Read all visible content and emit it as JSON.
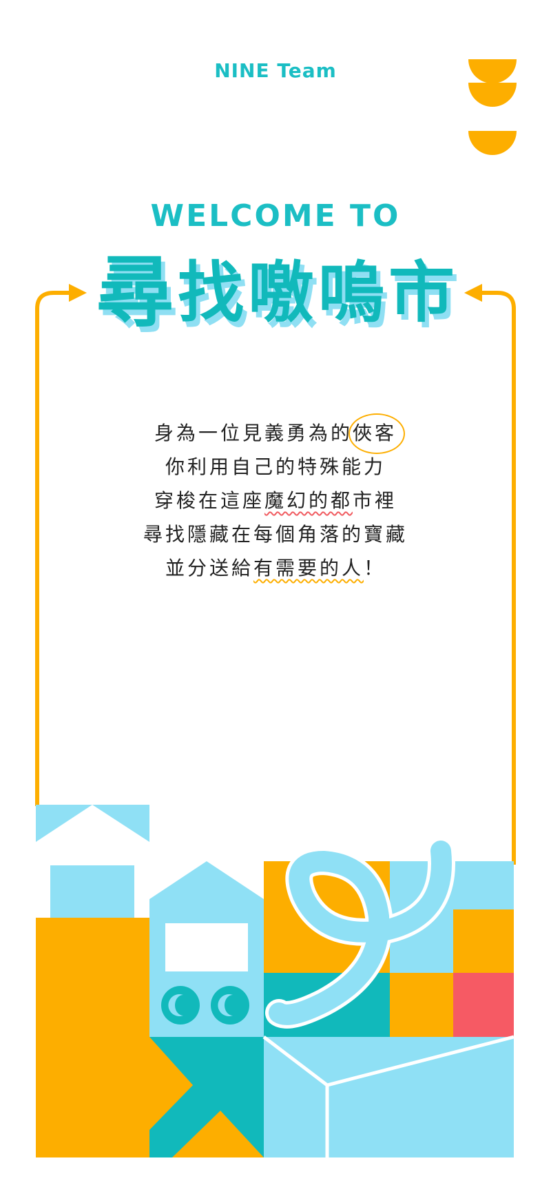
{
  "header": {
    "brand": "NINE Team"
  },
  "hero": {
    "welcome": "WELCOME TO",
    "title_chars": [
      "尋",
      "找",
      "噭",
      "嗚",
      "市"
    ]
  },
  "intro": {
    "line1_a": "身為一位見義勇為的",
    "line1_b": "俠客",
    "line2": "你利用自己的特殊能力",
    "line3_a": "穿梭在這座",
    "line3_b": "魔幻的都",
    "line3_c": "市裡",
    "line4": "尋找隱藏在每個角落的寶藏",
    "line5_a": "並分送給",
    "line5_b": "有需要的人",
    "line5_c": "！"
  },
  "colors": {
    "teal": "#1BBEC4",
    "orange": "#FDAE00",
    "light_blue": "#8FE0F5",
    "red": "#F65A64"
  }
}
